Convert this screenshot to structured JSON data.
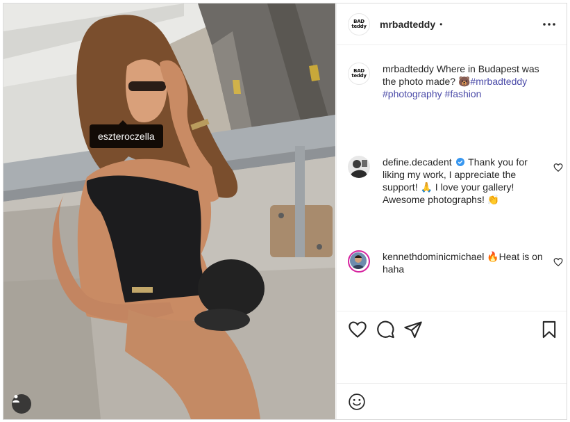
{
  "post": {
    "photo_alt": "Woman in black swimsuit holding a cap on a rooftop",
    "tagged_user": "eszteroczella"
  },
  "header": {
    "username": "mrbadteddy",
    "separator": "•",
    "logo_lines": [
      "BAD",
      "teddy"
    ]
  },
  "caption": {
    "username": "mrbadteddy",
    "text": " Where in Budapest was the photo made? ",
    "emoji": "🐻",
    "hashtags": [
      "#mrbadteddy",
      "#photography",
      "#fashion"
    ]
  },
  "comments": [
    {
      "username": "define.decadent",
      "verified": true,
      "text": " Thank you for liking my work, I appreciate the support! 🙏 I love your gallery! Awesome photographs! 👏"
    },
    {
      "username": "kennethdominicmichael",
      "verified": false,
      "text": "🔥Heat is on haha"
    }
  ],
  "icons": {
    "more": "more-horizontal-icon",
    "like": "heart-icon",
    "comment": "comment-bubble-icon",
    "share": "paper-plane-icon",
    "save": "bookmark-icon",
    "emoji": "smiley-icon",
    "tags": "user-tag-icon"
  },
  "colors": {
    "hashtag": "#4a4aa8",
    "verified": "#3897f0",
    "border": "#dbdbdb"
  }
}
